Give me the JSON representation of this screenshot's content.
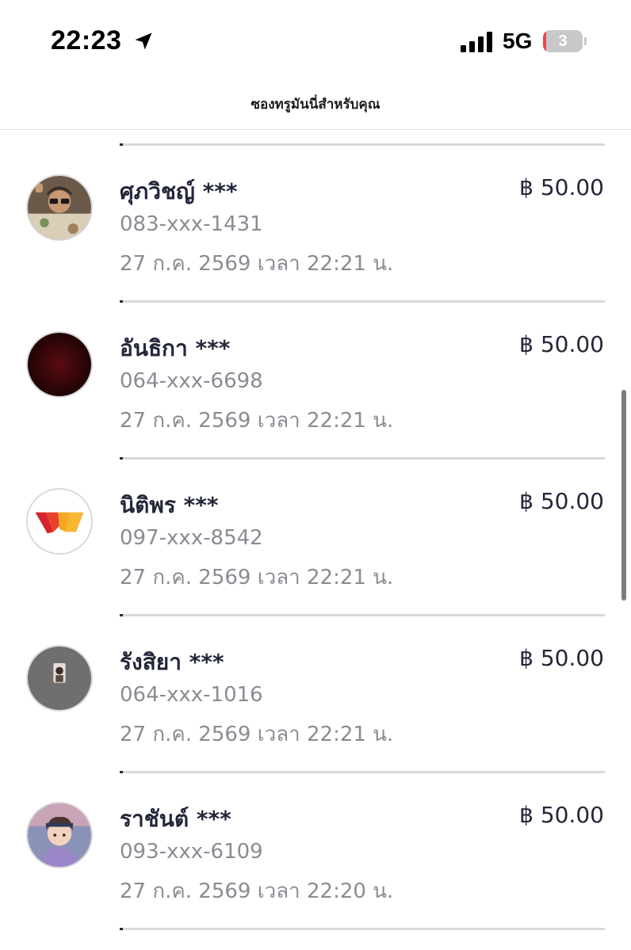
{
  "status_bar": {
    "time": "22:23",
    "network": "5G",
    "battery_level": "3",
    "battery_percent": 3,
    "icons": [
      "location-arrow-icon",
      "signal-bars-icon",
      "battery-icon"
    ]
  },
  "header": {
    "title": "ซองทรูมันนี่สำหรับคุณ"
  },
  "colors": {
    "text_primary": "#24273a",
    "text_secondary": "#8a8c94",
    "battery_low": "#e8474c",
    "divider": "#d8d8dc"
  },
  "transactions": [
    {
      "name": "ศุภวิชญ์ ***",
      "phone": "083-xxx-1431",
      "date": "27 ก.ค. 2569 เวลา 22:21 น.",
      "amount": "฿ 50.00",
      "avatar": "photo-avatar"
    },
    {
      "name": "อันธิกา ***",
      "phone": "064-xxx-6698",
      "date": "27 ก.ค. 2569 เวลา 22:21 น.",
      "amount": "฿ 50.00",
      "avatar": "dark-red-avatar"
    },
    {
      "name": "นิติพร ***",
      "phone": "097-xxx-8542",
      "date": "27 ก.ค. 2569 เวลา 22:21 น.",
      "amount": "฿ 50.00",
      "avatar": "logo-avatar"
    },
    {
      "name": "รังสิยา ***",
      "phone": "064-xxx-1016",
      "date": "27 ก.ค. 2569 เวลา 22:21 น.",
      "amount": "฿ 50.00",
      "avatar": "grey-photo-avatar"
    },
    {
      "name": "ราชันต์ ***",
      "phone": "093-xxx-6109",
      "date": "27 ก.ค. 2569 เวลา 22:20 น.",
      "amount": "฿ 50.00",
      "avatar": "anime-avatar"
    }
  ]
}
